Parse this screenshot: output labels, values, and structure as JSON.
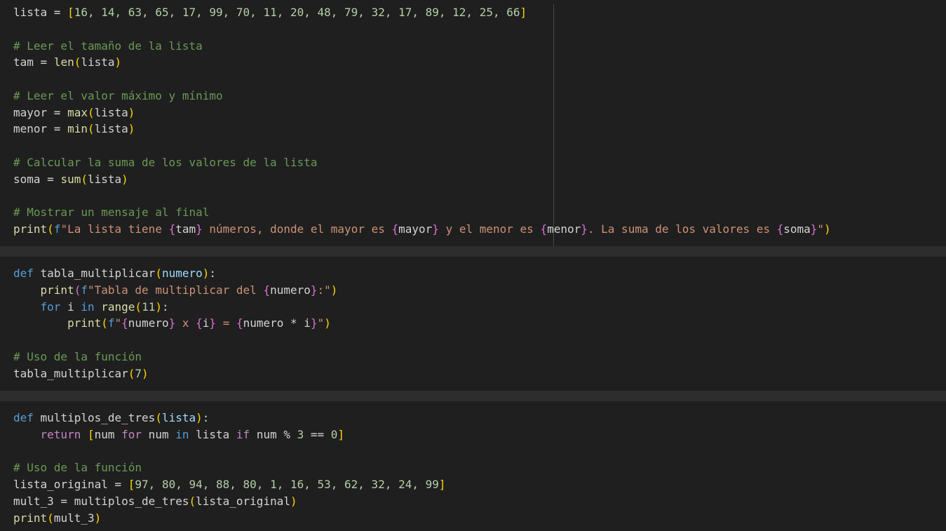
{
  "cells": [
    {
      "lines": [
        {
          "tokens": [
            {
              "t": "lista",
              "k": "plain"
            },
            {
              "t": " = ",
              "k": "op"
            },
            {
              "t": "[",
              "k": "b1"
            },
            {
              "t": "16, 14, 63, 65, 17, 99, 70, 11, 20, 48, 79, 32, 17, 89, 12, 25, 66",
              "k": "num"
            },
            {
              "t": "]",
              "k": "b1"
            }
          ]
        },
        {
          "tokens": []
        },
        {
          "tokens": [
            {
              "t": "# Leer el tamaño de la lista",
              "k": "com"
            }
          ]
        },
        {
          "tokens": [
            {
              "t": "tam",
              "k": "plain"
            },
            {
              "t": " = ",
              "k": "op"
            },
            {
              "t": "len",
              "k": "fn"
            },
            {
              "t": "(",
              "k": "b1"
            },
            {
              "t": "lista",
              "k": "plain"
            },
            {
              "t": ")",
              "k": "b1"
            }
          ]
        },
        {
          "tokens": []
        },
        {
          "tokens": [
            {
              "t": "# Leer el valor máximo y mínimo",
              "k": "com"
            }
          ]
        },
        {
          "tokens": [
            {
              "t": "mayor",
              "k": "plain"
            },
            {
              "t": " = ",
              "k": "op"
            },
            {
              "t": "max",
              "k": "fn"
            },
            {
              "t": "(",
              "k": "b1"
            },
            {
              "t": "lista",
              "k": "plain"
            },
            {
              "t": ")",
              "k": "b1"
            }
          ]
        },
        {
          "tokens": [
            {
              "t": "menor",
              "k": "plain"
            },
            {
              "t": " = ",
              "k": "op"
            },
            {
              "t": "min",
              "k": "fn"
            },
            {
              "t": "(",
              "k": "b1"
            },
            {
              "t": "lista",
              "k": "plain"
            },
            {
              "t": ")",
              "k": "b1"
            }
          ]
        },
        {
          "tokens": []
        },
        {
          "tokens": [
            {
              "t": "# Calcular la suma de los valores de la lista",
              "k": "com"
            }
          ]
        },
        {
          "tokens": [
            {
              "t": "soma",
              "k": "plain"
            },
            {
              "t": " = ",
              "k": "op"
            },
            {
              "t": "sum",
              "k": "fn"
            },
            {
              "t": "(",
              "k": "b1"
            },
            {
              "t": "lista",
              "k": "plain"
            },
            {
              "t": ")",
              "k": "b1"
            }
          ]
        },
        {
          "tokens": []
        },
        {
          "tokens": [
            {
              "t": "# Mostrar un mensaje al final",
              "k": "com"
            }
          ]
        },
        {
          "tokens": [
            {
              "t": "print",
              "k": "fn"
            },
            {
              "t": "(",
              "k": "b1"
            },
            {
              "t": "f",
              "k": "kw"
            },
            {
              "t": "\"La lista tiene ",
              "k": "str"
            },
            {
              "t": "{",
              "k": "b2"
            },
            {
              "t": "tam",
              "k": "plain"
            },
            {
              "t": "}",
              "k": "b2"
            },
            {
              "t": " números, donde el mayor es ",
              "k": "str"
            },
            {
              "t": "{",
              "k": "b2"
            },
            {
              "t": "mayor",
              "k": "plain"
            },
            {
              "t": "}",
              "k": "b2"
            },
            {
              "t": " y el menor es ",
              "k": "str"
            },
            {
              "t": "{",
              "k": "b2"
            },
            {
              "t": "menor",
              "k": "plain"
            },
            {
              "t": "}",
              "k": "b2"
            },
            {
              "t": ". La suma de los valores es ",
              "k": "str"
            },
            {
              "t": "{",
              "k": "b2"
            },
            {
              "t": "soma",
              "k": "plain"
            },
            {
              "t": "}",
              "k": "b2"
            },
            {
              "t": "\"",
              "k": "str"
            },
            {
              "t": ")",
              "k": "b1"
            }
          ]
        }
      ]
    },
    {
      "lines": [
        {
          "tokens": [
            {
              "t": "def",
              "k": "def"
            },
            {
              "t": " ",
              "k": "plain"
            },
            {
              "t": "tabla_multiplicar",
              "k": "plain"
            },
            {
              "t": "(",
              "k": "b1"
            },
            {
              "t": "numero",
              "k": "var"
            },
            {
              "t": ")",
              "k": "b1"
            },
            {
              "t": ":",
              "k": "plain"
            }
          ]
        },
        {
          "tokens": [
            {
              "t": "    ",
              "k": "plain"
            },
            {
              "t": "print",
              "k": "fn"
            },
            {
              "t": "(",
              "k": "b2"
            },
            {
              "t": "f",
              "k": "kw"
            },
            {
              "t": "\"Tabla de multiplicar del ",
              "k": "str"
            },
            {
              "t": "{",
              "k": "b2"
            },
            {
              "t": "numero",
              "k": "plain"
            },
            {
              "t": "}",
              "k": "b2"
            },
            {
              "t": ":\"",
              "k": "str"
            },
            {
              "t": ")",
              "k": "b1"
            }
          ]
        },
        {
          "tokens": [
            {
              "t": "    ",
              "k": "plain"
            },
            {
              "t": "for",
              "k": "kw"
            },
            {
              "t": " i ",
              "k": "plain"
            },
            {
              "t": "in",
              "k": "kw"
            },
            {
              "t": " ",
              "k": "plain"
            },
            {
              "t": "range",
              "k": "fn"
            },
            {
              "t": "(",
              "k": "b1"
            },
            {
              "t": "11",
              "k": "num"
            },
            {
              "t": ")",
              "k": "b1"
            },
            {
              "t": ":",
              "k": "plain"
            }
          ]
        },
        {
          "tokens": [
            {
              "t": "        ",
              "k": "plain"
            },
            {
              "t": "print",
              "k": "fn"
            },
            {
              "t": "(",
              "k": "b1"
            },
            {
              "t": "f",
              "k": "kw"
            },
            {
              "t": "\"",
              "k": "str"
            },
            {
              "t": "{",
              "k": "b2"
            },
            {
              "t": "numero",
              "k": "plain"
            },
            {
              "t": "}",
              "k": "b2"
            },
            {
              "t": " x ",
              "k": "str"
            },
            {
              "t": "{",
              "k": "b2"
            },
            {
              "t": "i",
              "k": "plain"
            },
            {
              "t": "}",
              "k": "b2"
            },
            {
              "t": " = ",
              "k": "str"
            },
            {
              "t": "{",
              "k": "b2"
            },
            {
              "t": "numero * i",
              "k": "plain"
            },
            {
              "t": "}",
              "k": "b2"
            },
            {
              "t": "\"",
              "k": "str"
            },
            {
              "t": ")",
              "k": "b1"
            }
          ]
        },
        {
          "tokens": []
        },
        {
          "tokens": [
            {
              "t": "# Uso de la función",
              "k": "com"
            }
          ]
        },
        {
          "tokens": [
            {
              "t": "tabla_multiplicar",
              "k": "plain"
            },
            {
              "t": "(",
              "k": "b1"
            },
            {
              "t": "7",
              "k": "num"
            },
            {
              "t": ")",
              "k": "b1"
            }
          ]
        }
      ]
    },
    {
      "lines": [
        {
          "tokens": [
            {
              "t": "def",
              "k": "def"
            },
            {
              "t": " ",
              "k": "plain"
            },
            {
              "t": "multiplos_de_tres",
              "k": "plain"
            },
            {
              "t": "(",
              "k": "b1"
            },
            {
              "t": "lista",
              "k": "var"
            },
            {
              "t": ")",
              "k": "b1"
            },
            {
              "t": ":",
              "k": "plain"
            }
          ]
        },
        {
          "tokens": [
            {
              "t": "    ",
              "k": "plain"
            },
            {
              "t": "return",
              "k": "ctl"
            },
            {
              "t": " ",
              "k": "plain"
            },
            {
              "t": "[",
              "k": "b1"
            },
            {
              "t": "num ",
              "k": "plain"
            },
            {
              "t": "for",
              "k": "ctl"
            },
            {
              "t": " num ",
              "k": "plain"
            },
            {
              "t": "in",
              "k": "kw"
            },
            {
              "t": " lista ",
              "k": "plain"
            },
            {
              "t": "if",
              "k": "ctl"
            },
            {
              "t": " num % ",
              "k": "plain"
            },
            {
              "t": "3",
              "k": "num"
            },
            {
              "t": " == ",
              "k": "plain"
            },
            {
              "t": "0",
              "k": "num"
            },
            {
              "t": "]",
              "k": "b1"
            }
          ]
        },
        {
          "tokens": []
        },
        {
          "tokens": [
            {
              "t": "# Uso de la función",
              "k": "com"
            }
          ]
        },
        {
          "tokens": [
            {
              "t": "lista_original",
              "k": "plain"
            },
            {
              "t": " = ",
              "k": "op"
            },
            {
              "t": "[",
              "k": "b1"
            },
            {
              "t": "97, 80, 94, 88, 80, 1, 16, 53, 62, 32, 24, 99",
              "k": "num"
            },
            {
              "t": "]",
              "k": "b1"
            }
          ]
        },
        {
          "tokens": [
            {
              "t": "mult_3",
              "k": "plain"
            },
            {
              "t": " = ",
              "k": "op"
            },
            {
              "t": "multiplos_de_tres",
              "k": "plain"
            },
            {
              "t": "(",
              "k": "b1"
            },
            {
              "t": "lista_original",
              "k": "plain"
            },
            {
              "t": ")",
              "k": "b1"
            }
          ]
        },
        {
          "tokens": [
            {
              "t": "print",
              "k": "fn"
            },
            {
              "t": "(",
              "k": "b1"
            },
            {
              "t": "mult_3",
              "k": "plain"
            },
            {
              "t": ")",
              "k": "b1"
            }
          ]
        }
      ]
    }
  ]
}
